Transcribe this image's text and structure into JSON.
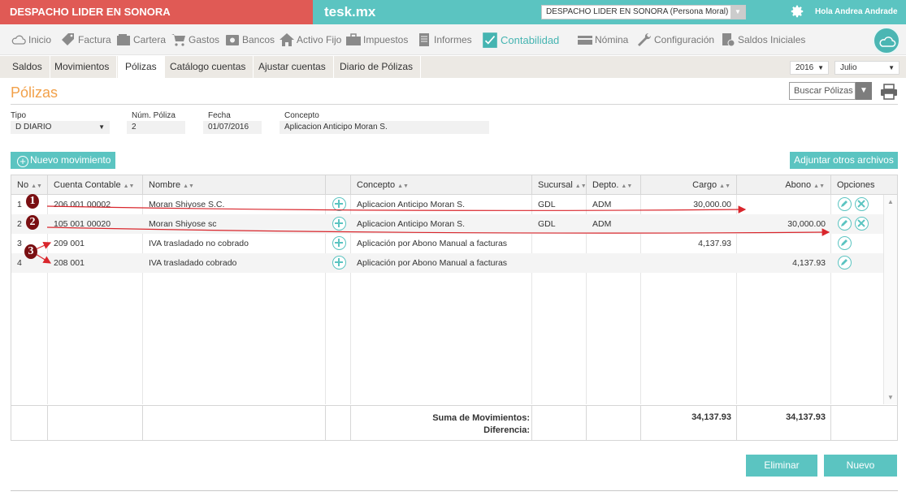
{
  "topbar": {
    "brand": "DESPACHO LIDER EN SONORA",
    "app_name": "tesk.mx",
    "company_select": "DESPACHO LIDER EN SONORA (Persona Moral)",
    "greeting": "Hola Andrea Andrade"
  },
  "mainnav": {
    "items": [
      {
        "label": "Inicio",
        "icon": "cloud-icon"
      },
      {
        "label": "Factura",
        "icon": "tag-icon"
      },
      {
        "label": "Cartera",
        "icon": "wallet-icon"
      },
      {
        "label": "Gastos",
        "icon": "cart-icon"
      },
      {
        "label": "Bancos",
        "icon": "safe-icon"
      },
      {
        "label": "Activo Fijo",
        "icon": "house-icon"
      },
      {
        "label": "Impuestos",
        "icon": "briefcase-icon"
      },
      {
        "label": "Informes",
        "icon": "document-icon"
      },
      {
        "label": "Contabilidad",
        "icon": "ledger-icon"
      },
      {
        "label": "Nómina",
        "icon": "card-icon"
      },
      {
        "label": "Configuración",
        "icon": "wrench-icon"
      },
      {
        "label": "Saldos Iniciales",
        "icon": "report-check-icon"
      }
    ]
  },
  "subtabs": [
    "Saldos",
    "Movimientos",
    "Pólizas",
    "Catálogo cuentas",
    "Ajustar cuentas",
    "Diario de Pólizas"
  ],
  "period": {
    "year": "2016",
    "month": "Julio"
  },
  "page": {
    "title": "Pólizas",
    "search_label": "Buscar Pólizas"
  },
  "form": {
    "tipo_label": "Tipo",
    "tipo_value": "D DIARIO",
    "num_label": "Núm. Póliza",
    "num_value": "2",
    "fecha_label": "Fecha",
    "fecha_value": "01/07/2016",
    "concepto_label": "Concepto",
    "concepto_value": "Aplicacion Anticipo Moran S."
  },
  "buttons": {
    "new_movement": "Nuevo movimiento",
    "attach": "Adjuntar otros archivos",
    "delete": "Eliminar",
    "new": "Nuevo"
  },
  "table": {
    "headers": [
      "No",
      "Cuenta Contable",
      "Nombre",
      "Concepto",
      "Sucursal",
      "Depto.",
      "Cargo",
      "Abono",
      "Opciones"
    ],
    "rows": [
      {
        "no": "1",
        "cuenta": "206 001 00002",
        "nombre": "Moran Shiyose S.C.",
        "concepto": "Aplicacion Anticipo Moran S.",
        "sucursal": "GDL",
        "depto": "ADM",
        "cargo": "30,000.00",
        "abono": ""
      },
      {
        "no": "2",
        "cuenta": "105 001 00020",
        "nombre": "Moran Shiyose sc",
        "concepto": "Aplicacion Anticipo Moran S.",
        "sucursal": "GDL",
        "depto": "ADM",
        "cargo": "",
        "abono": "30,000.00"
      },
      {
        "no": "3",
        "cuenta": "209 001",
        "nombre": "IVA trasladado no cobrado",
        "concepto": "Aplicación por Abono Manual a facturas",
        "sucursal": "",
        "depto": "",
        "cargo": "4,137.93",
        "abono": ""
      },
      {
        "no": "4",
        "cuenta": "208 001",
        "nombre": "IVA trasladado cobrado",
        "concepto": "Aplicación por Abono Manual a facturas",
        "sucursal": "",
        "depto": "",
        "cargo": "",
        "abono": "4,137.93"
      }
    ],
    "footer": {
      "sum_label": "Suma de Movimientos:",
      "diff_label": "Diferencia:",
      "cargo_total": "34,137.93",
      "abono_total": "34,137.93"
    }
  },
  "annotations": [
    "1",
    "2",
    "3"
  ],
  "colors": {
    "brand_red": "#e05a55",
    "teal": "#5bc4c1",
    "title_orange": "#f2a14a",
    "annotation_red": "#d9262c"
  }
}
